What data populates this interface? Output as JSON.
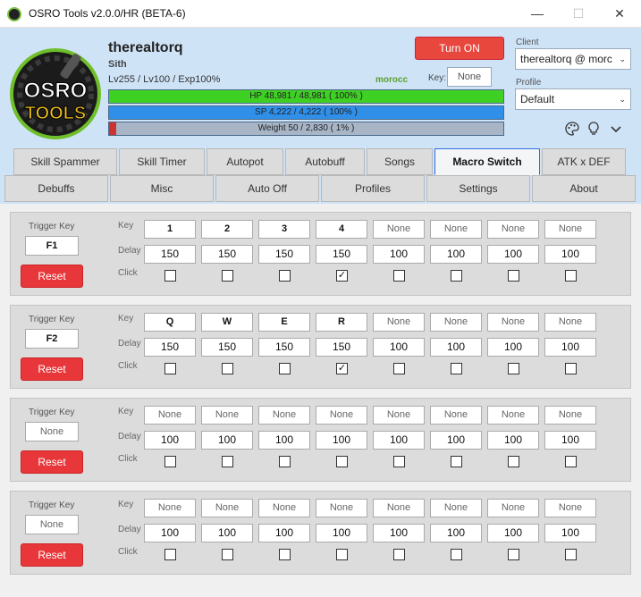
{
  "window": {
    "title": "OSRO Tools v2.0.0/HR (BETA-6)",
    "minimize": "—",
    "maximize": "☐",
    "close": "✕"
  },
  "logo": {
    "line1": "OSRO",
    "line2": "TOOLS"
  },
  "character": {
    "name": "therealtorq",
    "class": "Sith",
    "levels": "Lv255 / Lv100 / Exp100%",
    "server": "morocc",
    "hp": {
      "text": "HP  48,981  /  48,981  ( 100% )",
      "fraction": 1.0
    },
    "sp": {
      "text": "SP  4,222  /  4,222  ( 100% )",
      "fraction": 1.0
    },
    "weight": {
      "text": "Weight  50  /  2,830  ( 1% )",
      "fraction": 0.018
    }
  },
  "controls": {
    "turn_on": "Turn ON",
    "key_label": "Key:",
    "key_value": "None",
    "client_label": "Client",
    "client_value": "therealtorq @ morc",
    "profile_label": "Profile",
    "profile_value": "Default",
    "caret": "⌄"
  },
  "tabs_row1": [
    "Skill Spammer",
    "Skill Timer",
    "Autopot",
    "Autobuff",
    "Songs",
    "Macro Switch",
    "ATK x DEF"
  ],
  "tabs_row2": [
    "Debuffs",
    "Misc",
    "Auto Off",
    "Profiles",
    "Settings",
    "About"
  ],
  "active_tab": "Macro Switch",
  "labels": {
    "trigger": "Trigger Key",
    "key": "Key",
    "delay": "Delay",
    "click": "Click",
    "reset": "Reset"
  },
  "macros": [
    {
      "trigger": "F1",
      "keys": [
        "1",
        "2",
        "3",
        "4",
        "None",
        "None",
        "None",
        "None"
      ],
      "delays": [
        "150",
        "150",
        "150",
        "150",
        "100",
        "100",
        "100",
        "100"
      ],
      "clicks": [
        false,
        false,
        false,
        true,
        false,
        false,
        false,
        false
      ]
    },
    {
      "trigger": "F2",
      "keys": [
        "Q",
        "W",
        "E",
        "R",
        "None",
        "None",
        "None",
        "None"
      ],
      "delays": [
        "150",
        "150",
        "150",
        "150",
        "100",
        "100",
        "100",
        "100"
      ],
      "clicks": [
        false,
        false,
        false,
        true,
        false,
        false,
        false,
        false
      ]
    },
    {
      "trigger": "None",
      "keys": [
        "None",
        "None",
        "None",
        "None",
        "None",
        "None",
        "None",
        "None"
      ],
      "delays": [
        "100",
        "100",
        "100",
        "100",
        "100",
        "100",
        "100",
        "100"
      ],
      "clicks": [
        false,
        false,
        false,
        false,
        false,
        false,
        false,
        false
      ]
    },
    {
      "trigger": "None",
      "keys": [
        "None",
        "None",
        "None",
        "None",
        "None",
        "None",
        "None",
        "None"
      ],
      "delays": [
        "100",
        "100",
        "100",
        "100",
        "100",
        "100",
        "100",
        "100"
      ],
      "clicks": [
        false,
        false,
        false,
        false,
        false,
        false,
        false,
        false
      ]
    }
  ],
  "colors": {
    "accent_red": "#e8373a",
    "header_blue": "#cfe3f7",
    "hp_green": "#3fd024",
    "sp_blue": "#2f8fe9",
    "active_tab_border": "#2f6fdf",
    "server_green": "#5aa02c"
  }
}
